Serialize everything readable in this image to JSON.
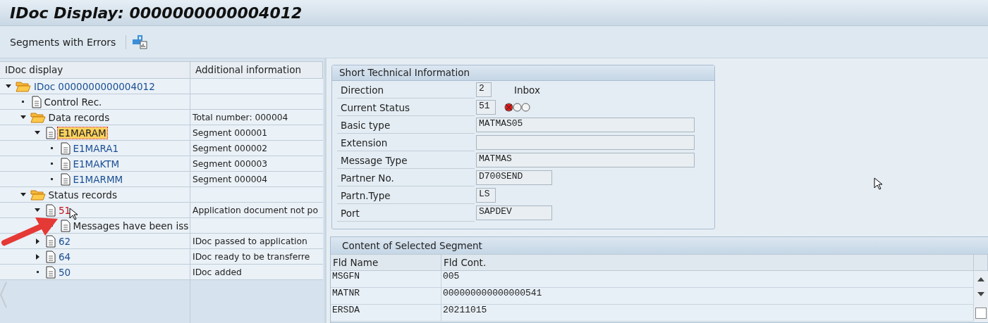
{
  "window": {
    "title": "IDoc Display: 0000000000004012"
  },
  "toolbar": {
    "button": "Segments with Errors"
  },
  "tree": {
    "columns": [
      "IDoc display",
      "Additional information"
    ],
    "nodes": [
      {
        "label": "IDoc 0000000000004012",
        "kind": "folder",
        "color": "#1a4f94",
        "selected": false,
        "expanded": true,
        "children": [
          {
            "label": "Control Rec.",
            "kind": "document",
            "selected": false
          },
          {
            "label": "Data records",
            "kind": "folder",
            "selected": false,
            "info": "Total number: 000004",
            "expanded": true,
            "children": [
              {
                "label": "E1MARAM",
                "kind": "document",
                "selected": true,
                "info": "Segment 000001",
                "expanded": true,
                "children": [
                  {
                    "label": "E1MARA1",
                    "kind": "document",
                    "color": "#1a4f94",
                    "selected": false,
                    "info": "Segment 000002"
                  },
                  {
                    "label": "E1MAKTM",
                    "kind": "document",
                    "color": "#1a4f94",
                    "selected": false,
                    "info": "Segment 000003"
                  },
                  {
                    "label": "E1MARMM",
                    "kind": "document",
                    "color": "#1a4f94",
                    "selected": false,
                    "info": "Segment 000004"
                  }
                ]
              }
            ]
          },
          {
            "label": "Status records",
            "kind": "folder",
            "selected": false,
            "expanded": true,
            "children": [
              {
                "label": "51",
                "kind": "document",
                "color": "#c3161c",
                "selected": false,
                "info": "Application document not po",
                "expanded": true,
                "children": [
                  {
                    "label": "Messages have been iss",
                    "kind": "document",
                    "selected": false
                  }
                ]
              },
              {
                "label": "62",
                "kind": "document",
                "color": "#1a4f94",
                "selected": false,
                "info": "IDoc passed to application",
                "expanded": false
              },
              {
                "label": "64",
                "kind": "document",
                "color": "#1a4f94",
                "selected": false,
                "info": "IDoc ready to be transferre",
                "expanded": false
              },
              {
                "label": "50",
                "kind": "document",
                "color": "#1a4f94",
                "selected": false,
                "info": "IDoc added"
              }
            ]
          }
        ]
      }
    ]
  },
  "short_info": {
    "title": "Short Technical Information",
    "fields": [
      {
        "label": "Direction",
        "value": "2",
        "note": "Inbox"
      },
      {
        "label": "Current Status",
        "value": "51",
        "lights": [
          {
            "on": true
          },
          {
            "on": false
          },
          {
            "on": false
          }
        ]
      },
      {
        "label": "Basic type",
        "value": "MATMAS05"
      },
      {
        "label": "Extension"
      },
      {
        "label": "Message Type",
        "value": "MATMAS"
      },
      {
        "label": "Partner No.",
        "value": "D700SEND"
      },
      {
        "label": "Partn.Type",
        "value": "LS"
      },
      {
        "label": "Port",
        "value": "SAPDEV"
      }
    ]
  },
  "segment": {
    "title": "Content of Selected Segment",
    "columns": [
      "Fld Name",
      "Fld Cont."
    ],
    "rows": [
      [
        "MSGFN",
        "005"
      ],
      [
        "MATNR",
        "000000000000000541"
      ],
      [
        "ERSDA",
        "20211015"
      ]
    ]
  }
}
